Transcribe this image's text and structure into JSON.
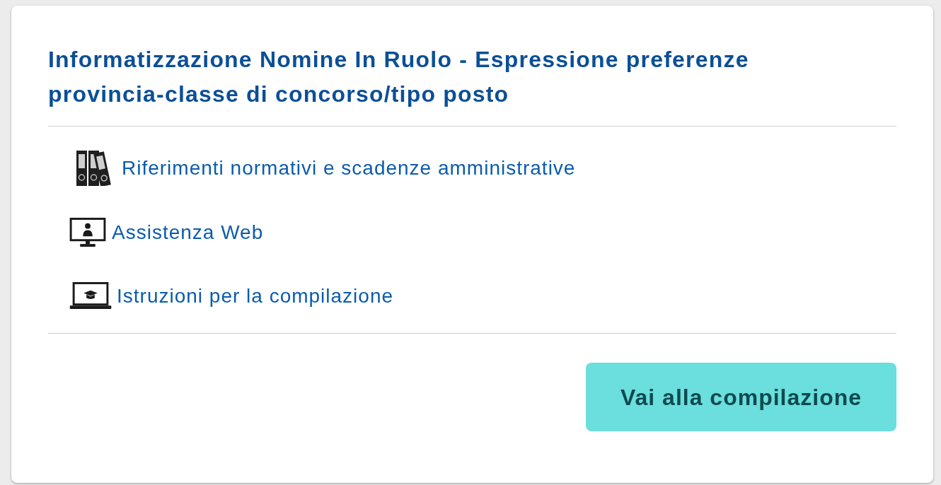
{
  "card": {
    "title": "Informatizzazione Nomine In Ruolo - Espressione preferenze provincia-classe di concorso/tipo posto",
    "links": [
      {
        "label": "Riferimenti normativi e scadenze amministrative"
      },
      {
        "label": "Assistenza Web"
      },
      {
        "label": "Istruzioni per la compilazione"
      }
    ],
    "button": {
      "label": "Vai alla compilazione"
    }
  }
}
